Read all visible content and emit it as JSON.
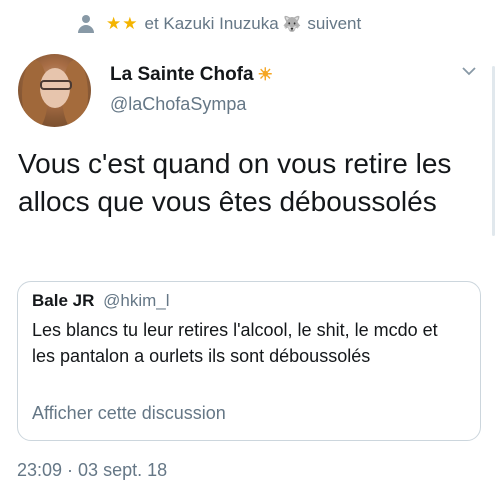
{
  "social_context": {
    "icon": "person-icon",
    "emoji": "★★",
    "text_before": "et Kazuki Inuzuka",
    "cat_emoji": "🐺",
    "text_after": "suivent"
  },
  "author": {
    "display_name": "La Sainte Chofa",
    "name_emoji": "☀",
    "handle": "@laChofaSympa"
  },
  "tweet": {
    "text": "Vous c'est quand on vous retire les allocs que vous êtes déboussolés"
  },
  "quoted_tweet": {
    "display_name": "Bale JR",
    "handle": "@hkim_l",
    "text": "Les blancs tu leur retires l'alcool, le shit, le mcdo et les pantalon a ourlets ils sont déboussolés",
    "link": "Afficher cette discussion"
  },
  "timestamp": "23:09 · 03 sept. 18",
  "colors": {
    "text": "#14171a",
    "muted": "#657786",
    "border": "#ccd6dd",
    "stars": "#f4b400"
  }
}
